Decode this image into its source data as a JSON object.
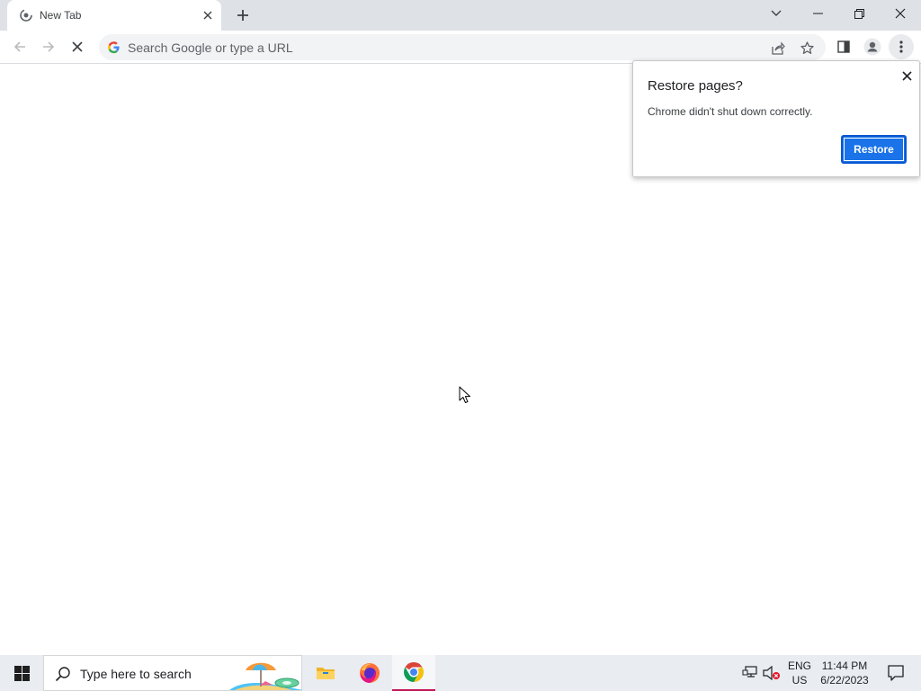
{
  "browser": {
    "tabs": [
      {
        "title": "New Tab"
      }
    ],
    "omnibox": {
      "placeholder": "Search Google or type a URL"
    }
  },
  "restore_bubble": {
    "title": "Restore pages?",
    "message": "Chrome didn't shut down correctly.",
    "restore_label": "Restore"
  },
  "taskbar": {
    "search_placeholder": "Type here to search",
    "apps": [
      "file-explorer",
      "firefox",
      "chrome"
    ],
    "active_app": "chrome",
    "tray": {
      "lang_line1": "ENG",
      "lang_line2": "US",
      "time": "11:44 PM",
      "date": "6/22/2023"
    }
  },
  "colors": {
    "accent": "#1a73e8",
    "tabstrip": "#dee1e6",
    "taskbar": "#e9ecf0"
  }
}
